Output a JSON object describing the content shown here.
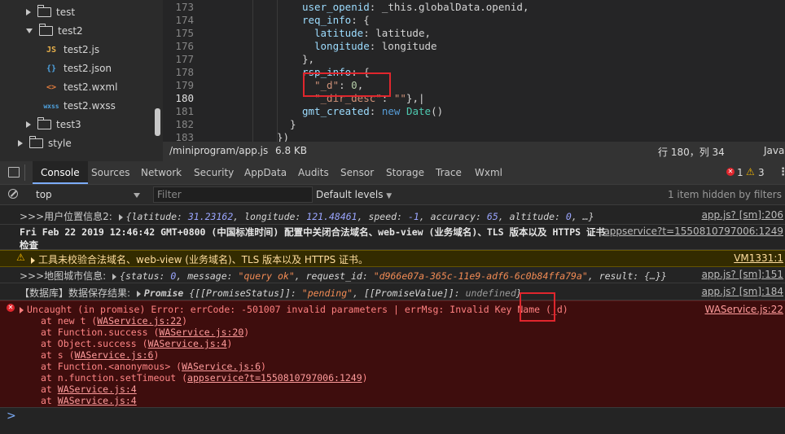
{
  "file_tree": {
    "items": [
      {
        "label": "test",
        "type": "folder",
        "open": false
      },
      {
        "label": "test2",
        "type": "folder",
        "open": true
      },
      {
        "label": "test2.js",
        "type": "file",
        "icon_text": "JS",
        "icon_color": "#e8b04a"
      },
      {
        "label": "test2.json",
        "type": "file",
        "icon_text": "{}",
        "icon_color": "#4fa3e0"
      },
      {
        "label": "test2.wxml",
        "type": "file",
        "icon_text": "<>",
        "icon_color": "#e07b3c"
      },
      {
        "label": "test2.wxss",
        "type": "file",
        "icon_text": "wxss",
        "icon_color": "#4fa3e0"
      },
      {
        "label": "test3",
        "type": "folder",
        "open": false
      },
      {
        "label": "style",
        "type": "folder",
        "open": false
      }
    ]
  },
  "editor": {
    "line_numbers": [
      "173",
      "174",
      "175",
      "176",
      "177",
      "178",
      "179",
      "180",
      "181",
      "182",
      "183"
    ],
    "current_line": "180",
    "lines": [
      {
        "key": "user_openid",
        "rest": ": _this.globalData.openid,"
      },
      {
        "key": "req_info",
        "rest": ": {"
      },
      {
        "key": "latitude",
        "rest": ": latitude,"
      },
      {
        "key": "longitude",
        "rest": ": longitude"
      },
      {
        "text": "},"
      },
      {
        "key": "rsp_info",
        "rest": ": {"
      },
      {
        "str": "\"_d\"",
        "rest": ": ",
        "num": "0",
        "end": ","
      },
      {
        "str": "\"_dir_desc\"",
        "rest": ": ",
        "str2": "\"\"",
        "end": "},|"
      },
      {
        "key": "gmt_created",
        "rest": ": ",
        "kw": "new",
        "fn": "Date",
        "end": "()"
      },
      {
        "text": "}"
      },
      {
        "text": "})"
      }
    ]
  },
  "status_bar": {
    "path": "/miniprogram/app.js",
    "size": "6.8 KB",
    "position": "行 180，列 34",
    "language": "Java"
  },
  "devtools": {
    "tabs": [
      "Console",
      "Sources",
      "Network",
      "Security",
      "AppData",
      "Audits",
      "Sensor",
      "Storage",
      "Trace",
      "Wxml"
    ],
    "active_tab": "Console",
    "error_count": "1",
    "warning_count": "3",
    "context": "top",
    "filter_placeholder": "Filter",
    "levels": "Default levels",
    "hidden": "1 item hidden by filters"
  },
  "console": {
    "m1": {
      "prefix": ">>>用户位置信息2:",
      "k1": "latitude",
      "v1": "31.23162",
      "k2": "longitude",
      "v2": "121.48461",
      "k3": "speed",
      "v3": "-1",
      "k4": "accuracy",
      "v4": "65",
      "k5": "altitude",
      "v5": "0",
      "tail": ", …}",
      "src": "app.js? [sm]:206"
    },
    "m2": {
      "line1": "Fri Feb 22 2019 12:46:42 GMT+0800 (中国标准时间) 配置中关闭合法域名、web-view (业务域名)、TLS 版本以及 HTTPS 证书",
      "line2": "检查",
      "src": "appservice?t=1550810797006:1249"
    },
    "m3": {
      "text": "工具未校验合法域名、web-view (业务域名)、TLS 版本以及 HTTPS 证书。",
      "src": "VM1331:1"
    },
    "m4": {
      "prefix": ">>>地图城市信息:",
      "k1": "status",
      "v1": "0",
      "k2": "message",
      "v2": "\"query ok\"",
      "k3": "request_id",
      "v3": "\"d966e07a-365c-11e9-adf6-6c0b84ffa79a\"",
      "k4": "result",
      "v4": "{…}",
      "src": "app.js? [sm]:151"
    },
    "m5": {
      "prefix": "【数据库】数据保存结果:",
      "label": "Promise",
      "k1": "[[PromiseStatus]]",
      "v1": "\"pending\"",
      "k2": "[[PromiseValue]]",
      "v2": "undefined",
      "src": "app.js? [sm]:184"
    },
    "err": {
      "message": "Uncaught (in promise) Error: errCode: -501007 invalid parameters | errMsg: Invalid Key Name (_d)",
      "src": "WAService.js:22",
      "stack": [
        {
          "pre": "at new t (",
          "link": "WAService.js:22",
          "post": ")"
        },
        {
          "pre": "at Function.success (",
          "link": "WAService.js:20",
          "post": ")"
        },
        {
          "pre": "at Object.success (",
          "link": "WAService.js:4",
          "post": ")"
        },
        {
          "pre": "at s (",
          "link": "WAService.js:6",
          "post": ")"
        },
        {
          "pre": "at Function.<anonymous> (",
          "link": "WAService.js:6",
          "post": ")"
        },
        {
          "pre": "at n.function.setTimeout (",
          "link": "appservice?t=1550810797006:1249",
          "post": ")"
        },
        {
          "pre": "at ",
          "link": "WAService.js:4",
          "post": ""
        },
        {
          "pre": "at ",
          "link": "WAService.js:4",
          "post": ""
        }
      ]
    },
    "prompt": ">"
  }
}
